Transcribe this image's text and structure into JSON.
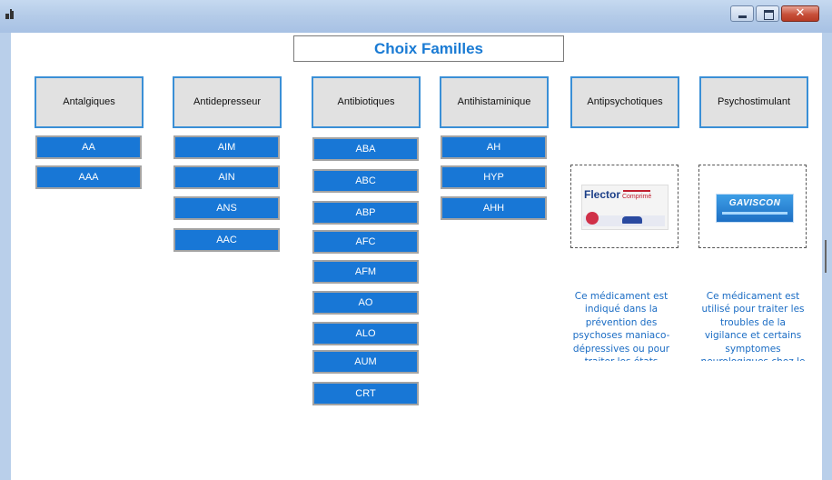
{
  "window": {
    "title_text": "",
    "close_glyph": "✕"
  },
  "header": {
    "title": "Choix Familles"
  },
  "families": [
    {
      "label": "Antalgiques",
      "subs": [
        "AA",
        "AAA"
      ]
    },
    {
      "label": "Antidepresseur",
      "subs": [
        "AIM",
        "AIN",
        "ANS",
        "AAC"
      ]
    },
    {
      "label": "Antibiotiques",
      "subs": [
        "ABA",
        "ABC",
        "ABP",
        "AFC",
        "AFM",
        "AO",
        "ALO",
        "AUM",
        "CRT"
      ]
    },
    {
      "label": "Antihistaminique",
      "subs": [
        "AH",
        "HYP",
        "AHH"
      ]
    },
    {
      "label": "Antipsychotiques",
      "subs": []
    },
    {
      "label": "Psychostimulant",
      "subs": []
    }
  ],
  "products": [
    {
      "image_brand": "Flector",
      "description": "Ce médicament est indiqué dans la prévention des psychoses maniaco-dépressives ou pour traiter les états"
    },
    {
      "image_brand": "GAVISCON",
      "description": "Ce médicament est utilisé pour traiter les troubles de la vigilance et certains symptomes neurologiques chez le sujet agé"
    }
  ],
  "colors": {
    "accent": "#1a7bd4",
    "button_bg": "#1877d6",
    "header_border": "#3a8fd6",
    "description_text": "#1a6cc4"
  },
  "icons": {
    "app": "app-icon",
    "minimize": "minimize-icon",
    "maximize": "maximize-icon",
    "close": "close-icon"
  }
}
